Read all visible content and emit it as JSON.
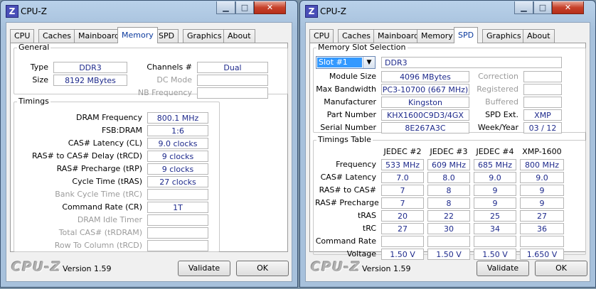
{
  "left_window": {
    "title": "CPU-Z",
    "icon_letter": "Z",
    "tabs": [
      "CPU",
      "Caches",
      "Mainboard",
      "Memory",
      "SPD",
      "Graphics",
      "About"
    ],
    "active_tab": "Memory",
    "general": {
      "legend": "General",
      "type_label": "Type",
      "type_value": "DDR3",
      "size_label": "Size",
      "size_value": "8192 MBytes",
      "channels_label": "Channels #",
      "channels_value": "Dual",
      "dc_mode_label": "DC Mode",
      "dc_mode_value": "",
      "nb_freq_label": "NB Frequency",
      "nb_freq_value": ""
    },
    "timings": {
      "legend": "Timings",
      "rows": [
        {
          "label": "DRAM Frequency",
          "value": "800.1 MHz",
          "enabled": true
        },
        {
          "label": "FSB:DRAM",
          "value": "1:6",
          "enabled": true
        },
        {
          "label": "CAS# Latency (CL)",
          "value": "9.0 clocks",
          "enabled": true
        },
        {
          "label": "RAS# to CAS# Delay (tRCD)",
          "value": "9 clocks",
          "enabled": true
        },
        {
          "label": "RAS# Precharge (tRP)",
          "value": "9 clocks",
          "enabled": true
        },
        {
          "label": "Cycle Time (tRAS)",
          "value": "27 clocks",
          "enabled": true
        },
        {
          "label": "Bank Cycle Time (tRC)",
          "value": "",
          "enabled": false
        },
        {
          "label": "Command Rate (CR)",
          "value": "1T",
          "enabled": true
        },
        {
          "label": "DRAM Idle Timer",
          "value": "",
          "enabled": false
        },
        {
          "label": "Total CAS# (tRDRAM)",
          "value": "",
          "enabled": false
        },
        {
          "label": "Row To Column (tRCD)",
          "value": "",
          "enabled": false
        }
      ]
    },
    "footer": {
      "logo": "CPU-Z",
      "version": "Version 1.59",
      "validate_label": "Validate",
      "ok_label": "OK"
    }
  },
  "right_window": {
    "title": "CPU-Z",
    "icon_letter": "Z",
    "tabs": [
      "CPU",
      "Caches",
      "Mainboard",
      "Memory",
      "SPD",
      "Graphics",
      "About"
    ],
    "active_tab": "SPD",
    "slot": {
      "legend": "Memory Slot Selection",
      "selected": "Slot #1",
      "type_value": "DDR3",
      "left_rows": [
        {
          "label": "Module Size",
          "value": "4096 MBytes"
        },
        {
          "label": "Max Bandwidth",
          "value": "PC3-10700 (667 MHz)"
        },
        {
          "label": "Manufacturer",
          "value": "Kingston"
        },
        {
          "label": "Part Number",
          "value": "KHX1600C9D3/4GX"
        },
        {
          "label": "Serial Number",
          "value": "8E267A3C"
        }
      ],
      "right_rows": [
        {
          "label": "Correction",
          "value": "",
          "enabled": false
        },
        {
          "label": "Registered",
          "value": "",
          "enabled": false
        },
        {
          "label": "Buffered",
          "value": "",
          "enabled": false
        },
        {
          "label": "SPD Ext.",
          "value": "XMP",
          "enabled": true
        },
        {
          "label": "Week/Year",
          "value": "03 / 12",
          "enabled": true
        }
      ]
    },
    "timings_table": {
      "legend": "Timings Table",
      "columns": [
        "JEDEC #2",
        "JEDEC #3",
        "JEDEC #4",
        "XMP-1600"
      ],
      "rows": [
        {
          "label": "Frequency",
          "values": [
            "533 MHz",
            "609 MHz",
            "685 MHz",
            "800 MHz"
          ]
        },
        {
          "label": "CAS# Latency",
          "values": [
            "7.0",
            "8.0",
            "9.0",
            "9.0"
          ]
        },
        {
          "label": "RAS# to CAS#",
          "values": [
            "7",
            "8",
            "9",
            "9"
          ]
        },
        {
          "label": "RAS# Precharge",
          "values": [
            "7",
            "8",
            "9",
            "9"
          ]
        },
        {
          "label": "tRAS",
          "values": [
            "20",
            "22",
            "25",
            "27"
          ]
        },
        {
          "label": "tRC",
          "values": [
            "27",
            "30",
            "34",
            "36"
          ]
        },
        {
          "label": "Command Rate",
          "values": [
            "",
            "",
            "",
            ""
          ]
        },
        {
          "label": "Voltage",
          "values": [
            "1.50 V",
            "1.50 V",
            "1.50 V",
            "1.650 V"
          ]
        }
      ]
    },
    "footer": {
      "logo": "CPU-Z",
      "version": "Version 1.59",
      "validate_label": "Validate",
      "ok_label": "OK"
    }
  }
}
